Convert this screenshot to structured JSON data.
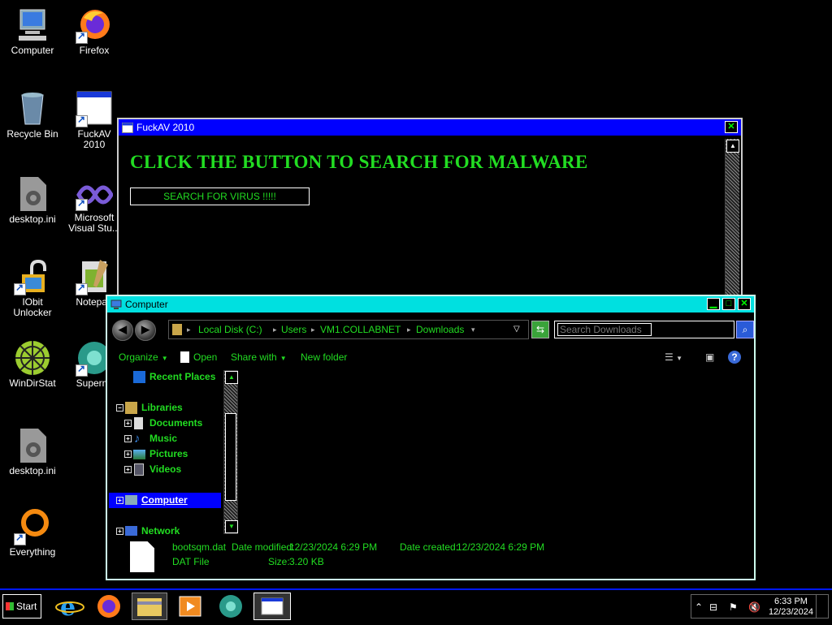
{
  "desktop": {
    "icons": [
      {
        "label": "Computer"
      },
      {
        "label": "Firefox"
      },
      {
        "label": "Recycle Bin"
      },
      {
        "label": "FuckAV 2010"
      },
      {
        "label": "desktop.ini"
      },
      {
        "label": "Microsoft Visual Stu..."
      },
      {
        "label": "IObit Unlocker"
      },
      {
        "label": "Notepad"
      },
      {
        "label": "WinDirStat"
      },
      {
        "label": "Supermi"
      },
      {
        "label": "desktop.ini"
      },
      {
        "label": "Everything"
      }
    ]
  },
  "av_window": {
    "title": "FuckAV 2010",
    "heading": "CLICK THE BUTTON TO SEARCH FOR MALWARE",
    "button_label": "SEARCH FOR VIRUS !!!!!",
    "close_glyph": "✕"
  },
  "explorer": {
    "title": "Computer",
    "breadcrumb": [
      "Local Disk (C:)",
      "Users",
      "VM1.COLLABNET",
      "Downloads"
    ],
    "search_placeholder": "Search Downloads",
    "commands": {
      "organize": "Organize",
      "open": "Open",
      "share": "Share with",
      "new_folder": "New folder"
    },
    "tree": [
      {
        "label": "Recent Places",
        "expander": ""
      },
      {
        "label": "Libraries",
        "expander": "−"
      },
      {
        "label": "Documents",
        "expander": "+"
      },
      {
        "label": "Music",
        "expander": "+"
      },
      {
        "label": "Pictures",
        "expander": "+"
      },
      {
        "label": "Videos",
        "expander": "+"
      },
      {
        "label": "Computer",
        "expander": "+"
      },
      {
        "label": "Network",
        "expander": "+"
      }
    ],
    "details": {
      "filename": "bootsqm.dat",
      "date_modified_label": "Date modified:",
      "date_modified": "12/23/2024 6:29 PM",
      "date_created_label": "Date created:",
      "date_created": "12/23/2024 6:29 PM",
      "type": "DAT File",
      "size_label": "Size:",
      "size": "3.20 KB"
    }
  },
  "taskbar": {
    "start_label": "Start",
    "time": "6:33 PM",
    "date": "12/23/2024"
  },
  "colors": {
    "accent_green": "#22dd22",
    "title_blue": "#0000ff",
    "title_cyan": "#00e0e0"
  }
}
